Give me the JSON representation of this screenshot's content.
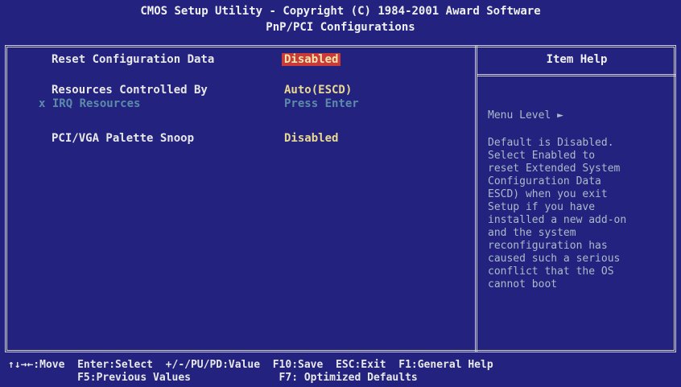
{
  "header": {
    "line1": "CMOS Setup Utility - Copyright (C) 1984-2001 Award Software",
    "line2": "PnP/PCI Configurations"
  },
  "settings": [
    {
      "label": "Reset Configuration Data",
      "value": "Disabled"
    },
    {
      "label": "Resources Controlled By",
      "value": "Auto(ESCD)"
    },
    {
      "label": "x IRQ Resources",
      "value": "Press Enter"
    },
    {
      "label": "PCI/VGA Palette Snoop",
      "value": "Disabled"
    }
  ],
  "help": {
    "title": "Item Help",
    "menu_level": "Menu Level   ►",
    "text": "Default is Disabled.\nSelect Enabled to\nreset Extended System\nConfiguration Data\nESCD) when you exit\nSetup if you have\ninstalled a new add-on\nand the system\nreconfiguration has\ncaused such a serious\nconflict that the OS\ncannot boot"
  },
  "footer": {
    "line1": "↑↓→←:Move  Enter:Select  +/-/PU/PD:Value  F10:Save  ESC:Exit  F1:General Help",
    "line2": "           F5:Previous Values              F7: Optimized Defaults"
  },
  "colors": {
    "background": "#23237f",
    "selection": "#c93a3a",
    "value_text": "#e8d890",
    "dim_text": "#5c8ba9"
  }
}
